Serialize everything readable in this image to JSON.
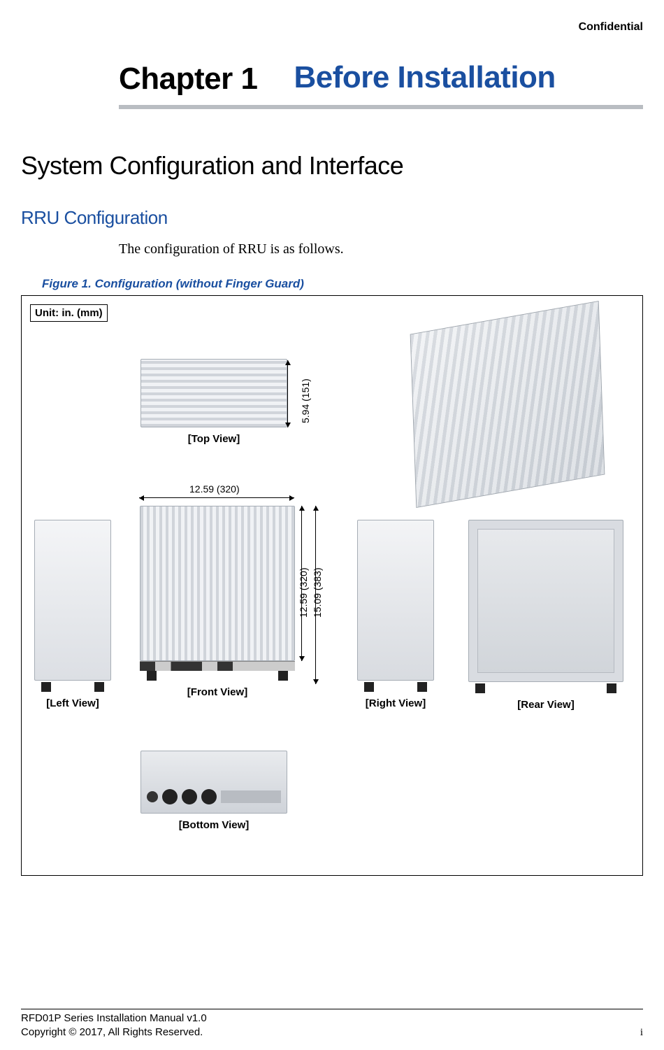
{
  "header": {
    "confidential": "Confidential"
  },
  "chapter": {
    "number": "Chapter 1",
    "title": "Before Installation"
  },
  "section": {
    "h1": "System Configuration and Interface",
    "h2": "RRU Configuration",
    "body": "The configuration of RRU is as follows."
  },
  "figure": {
    "caption": "Figure 1. Configuration (without Finger Guard)",
    "unit": "Unit: in. (mm)",
    "views": {
      "top": "[Top View]",
      "left": "[Left View]",
      "front": "[Front View]",
      "right": "[Right View]",
      "rear": "[Rear View]",
      "bottom": "[Bottom View]"
    },
    "dimensions": {
      "depth": "5.94 (151)",
      "width": "12.59 (320)",
      "height_body": "12.59 (320)",
      "height_overall": "15.09 (383)"
    }
  },
  "footer": {
    "manual": "RFD01P Series Installation Manual   v1.0",
    "copyright": "Copyright © 2017, All Rights Reserved.",
    "page": "i"
  }
}
